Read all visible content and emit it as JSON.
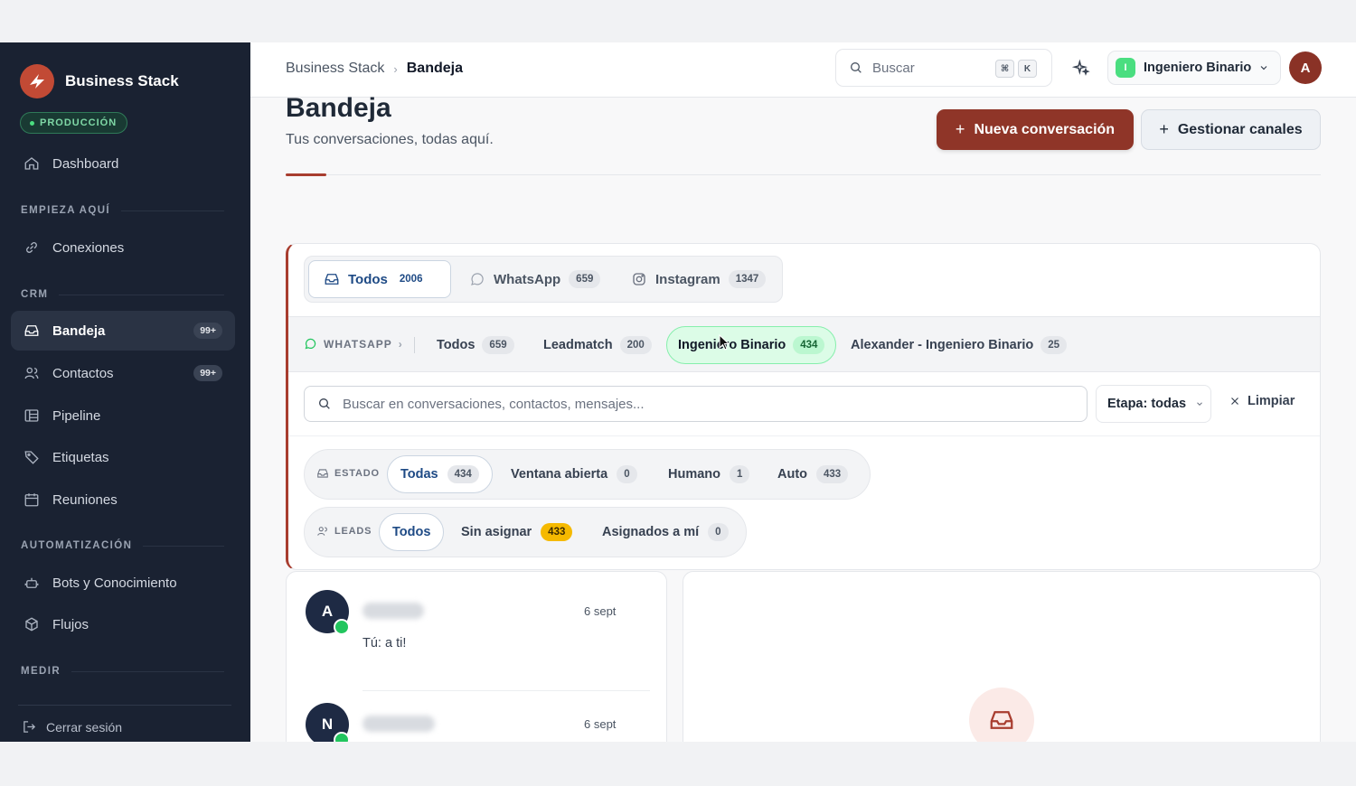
{
  "app": {
    "brand_name": "Business Stack",
    "env_badge": "PRODUCCIÓN",
    "accent_color": "#8f3528",
    "sidebar_color": "#1a2232"
  },
  "sidebar": {
    "dashboard": "Dashboard",
    "section_start": "EMPIEZA AQUÍ",
    "conexiones": "Conexiones",
    "section_crm": "CRM",
    "bandeja": "Bandeja",
    "bandeja_badge": "99+",
    "contactos": "Contactos",
    "contactos_badge": "99+",
    "pipeline": "Pipeline",
    "etiquetas": "Etiquetas",
    "reuniones": "Reuniones",
    "section_auto": "AUTOMATIZACIÓN",
    "bots": "Bots y Conocimiento",
    "flujos": "Flujos",
    "section_measure": "MEDIR",
    "logout": "Cerrar sesión"
  },
  "header": {
    "breadcrumb_root": "Business Stack",
    "breadcrumb_sep": "›",
    "breadcrumb_current": "Bandeja",
    "search_placeholder": "Buscar",
    "kbd_cmd": "⌘",
    "kbd_k": "K",
    "workspace_initial": "I",
    "workspace_name": "Ingeniero Binario",
    "user_initial": "A"
  },
  "page": {
    "title": "Bandeja",
    "subtitle": "Tus conversaciones, todas aquí.",
    "new_conversation": "Nueva conversación",
    "manage_channels": "Gestionar canales",
    "plus": "+"
  },
  "channels": {
    "todos": "Todos",
    "todos_count": "2006",
    "whatsapp": "WhatsApp",
    "whatsapp_count": "659",
    "instagram": "Instagram",
    "instagram_count": "1347"
  },
  "whatsapp_sub": {
    "label": "WHATSAPP",
    "chevron": "›",
    "todos": "Todos",
    "todos_count": "659",
    "leadmatch": "Leadmatch",
    "leadmatch_count": "200",
    "ingeniero": "Ingeniero Binario",
    "ingeniero_count": "434",
    "alexander": "Alexander - Ingeniero Binario",
    "alexander_count": "25"
  },
  "filters": {
    "search_placeholder": "Buscar en conversaciones, contactos, mensajes...",
    "stage": "Etapa: todas",
    "clear": "Limpiar",
    "estado_label": "ESTADO",
    "estado_todas": "Todas",
    "estado_todas_count": "434",
    "ventana": "Ventana abierta",
    "ventana_count": "0",
    "humano": "Humano",
    "humano_count": "1",
    "auto": "Auto",
    "auto_count": "433",
    "leads_label": "LEADS",
    "leads_todos": "Todos",
    "sin_asignar": "Sin asignar",
    "sin_asignar_count": "433",
    "asignados": "Asignados a mí",
    "asignados_count": "0"
  },
  "conversations": [
    {
      "initial": "A",
      "date": "6 sept",
      "preview": "Tú: a ti!"
    },
    {
      "initial": "N",
      "date": "6 sept",
      "preview": ""
    }
  ]
}
